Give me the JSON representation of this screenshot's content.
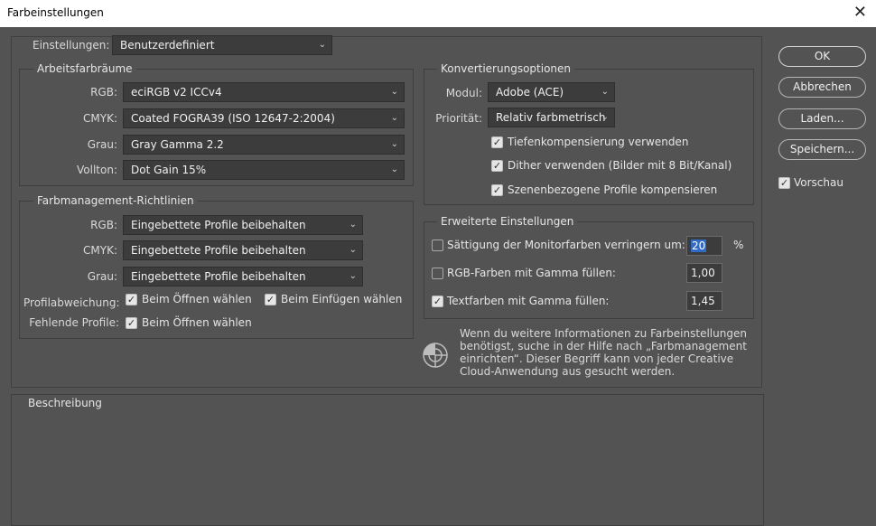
{
  "window": {
    "title": "Farbeinstellungen"
  },
  "settings": {
    "label": "Einstellungen:",
    "value": "Benutzerdefiniert"
  },
  "workspaces": {
    "title": "Arbeitsfarbräume",
    "rgb_label": "RGB:",
    "rgb_value": "eciRGB v2 ICCv4",
    "cmyk_label": "CMYK:",
    "cmyk_value": "Coated FOGRA39 (ISO 12647-2:2004)",
    "gray_label": "Grau:",
    "gray_value": "Gray Gamma 2.2",
    "spot_label": "Vollton:",
    "spot_value": "Dot Gain 15%"
  },
  "policies": {
    "title": "Farbmanagement-Richtlinien",
    "rgb_label": "RGB:",
    "rgb_value": "Eingebettete Profile beibehalten",
    "cmyk_label": "CMYK:",
    "cmyk_value": "Eingebettete Profile beibehalten",
    "gray_label": "Grau:",
    "gray_value": "Eingebettete Profile beibehalten",
    "mismatch_label": "Profilabweichung:",
    "mismatch_open": "Beim Öffnen wählen",
    "mismatch_paste": "Beim Einfügen wählen",
    "missing_label": "Fehlende Profile:",
    "missing_open": "Beim Öffnen wählen"
  },
  "conversion": {
    "title": "Konvertierungsoptionen",
    "engine_label": "Modul:",
    "engine_value": "Adobe (ACE)",
    "intent_label": "Priorität:",
    "intent_value": "Relativ farbmetrisch",
    "bpc": "Tiefenkompensierung verwenden",
    "dither": "Dither verwenden (Bilder mit 8 Bit/Kanal)",
    "scene": "Szenenbezogene Profile kompensieren"
  },
  "advanced": {
    "title": "Erweiterte Einstellungen",
    "desaturate": "Sättigung der Monitorfarben verringern um:",
    "desaturate_value": "20",
    "desaturate_unit": "%",
    "blend_rgb": "RGB-Farben mit Gamma füllen:",
    "blend_rgb_value": "1,00",
    "blend_text": "Textfarben mit Gamma füllen:",
    "blend_text_value": "1,45"
  },
  "info": {
    "text": "Wenn du weitere Informationen zu Farbeinstellungen benötigst, suche in der Hilfe nach „Farbmanagement einrichten“. Dieser Begriff kann von jeder Creative Cloud-Anwendung aus gesucht werden."
  },
  "description": {
    "title": "Beschreibung"
  },
  "buttons": {
    "ok": "OK",
    "cancel": "Abbrechen",
    "load": "Laden...",
    "save": "Speichern...",
    "preview": "Vorschau"
  },
  "icons": {
    "close": "close-icon",
    "chevron": "chevron-down-icon",
    "check": "checkmark-icon",
    "info": "color-management-info-icon"
  },
  "colors": {
    "background": "#535353",
    "field": "#3c3c3c",
    "selection": "#2f6ac6"
  }
}
